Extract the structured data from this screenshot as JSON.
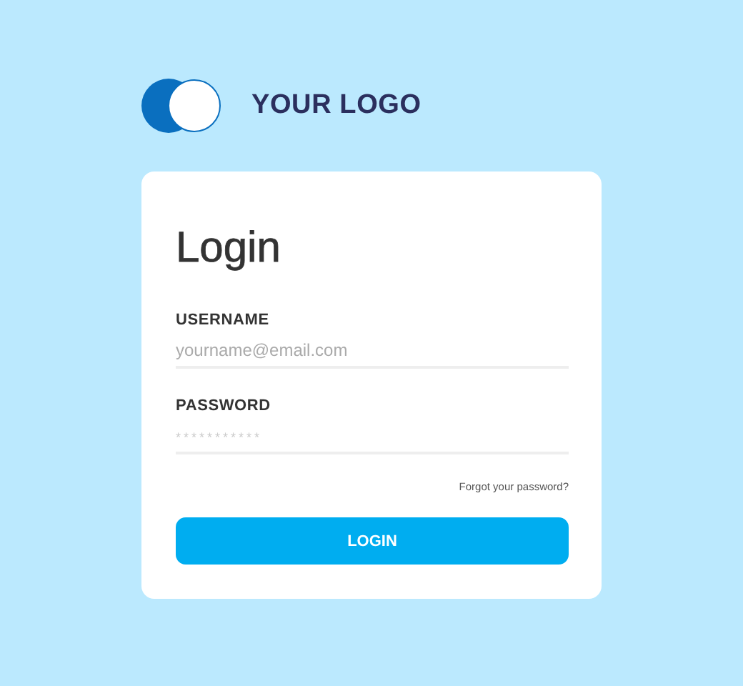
{
  "logo": {
    "text": "YOUR LOGO"
  },
  "card": {
    "title": "Login",
    "fields": [
      {
        "label": "USERNAME",
        "placeholder": "yourname@email.com",
        "kind": "plain"
      },
      {
        "label": "PASSWORD",
        "placeholder": "***********",
        "kind": "masked"
      }
    ],
    "forgot_link": "Forgot your password?",
    "button": "LOGIN"
  }
}
